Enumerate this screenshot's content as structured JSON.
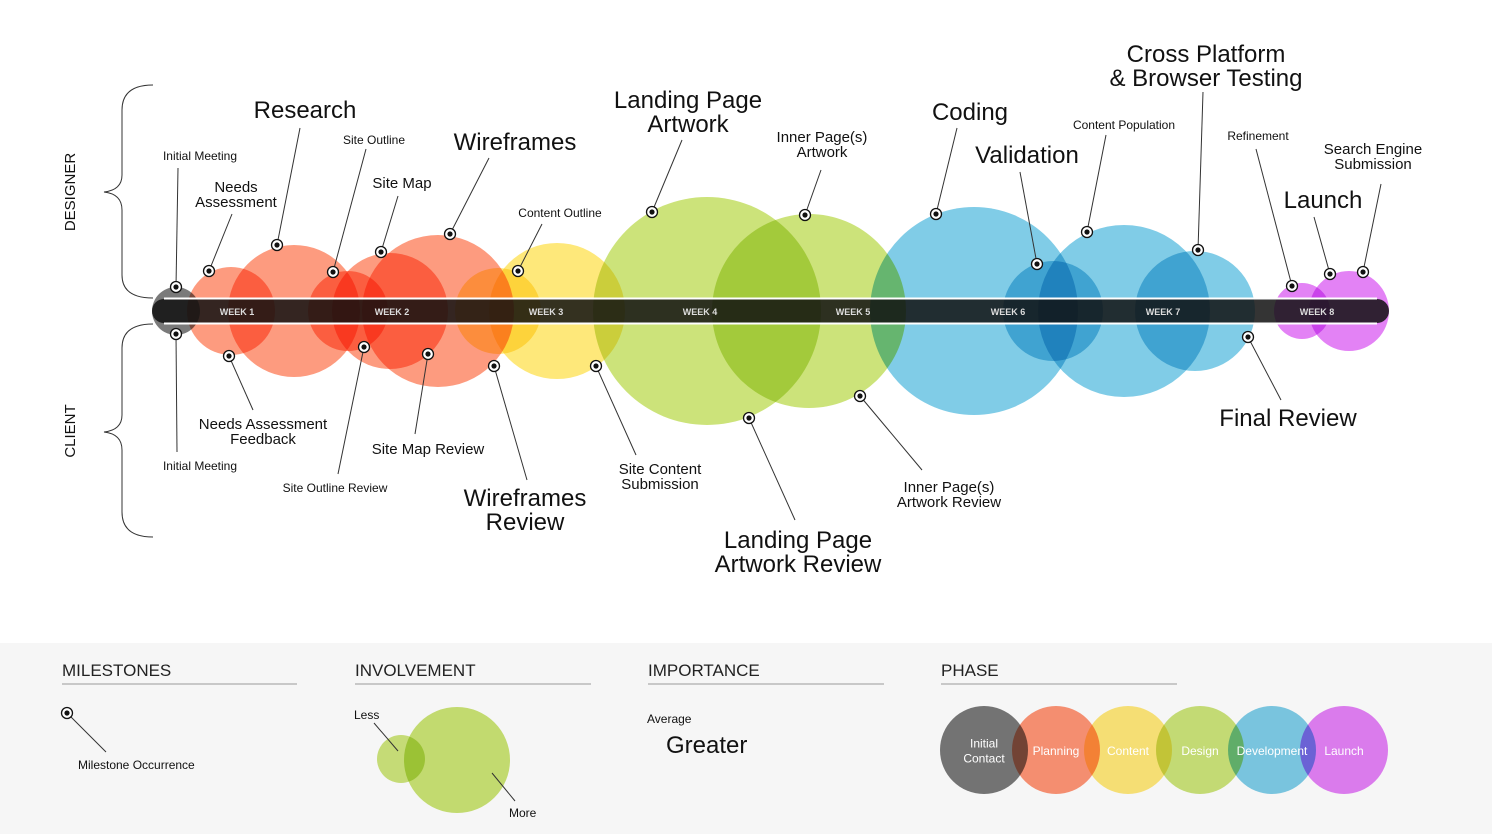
{
  "sides": {
    "designer": "DESIGNER",
    "client": "CLIENT"
  },
  "weeks": [
    "WEEK 1",
    "WEEK 2",
    "WEEK 3",
    "WEEK 4",
    "WEEK 5",
    "WEEK 6",
    "WEEK 7",
    "WEEK 8"
  ],
  "colors": {
    "initial_contact": "#6b6b6b",
    "planning": "#fd8a68",
    "content": "#fee56c",
    "design": "#c6e06c",
    "development": "#72c7e4",
    "launch": "#e074f4",
    "timeline_bar": "#1a1a1a",
    "legend_bg": "#f6f6f6"
  },
  "designer_milestones": [
    {
      "lines": [
        "Initial Meeting"
      ],
      "size": "sm"
    },
    {
      "lines": [
        "Needs",
        "Assessment"
      ],
      "size": "md"
    },
    {
      "lines": [
        "Research"
      ],
      "size": "lg"
    },
    {
      "lines": [
        "Site Outline"
      ],
      "size": "sm"
    },
    {
      "lines": [
        "Site Map"
      ],
      "size": "md"
    },
    {
      "lines": [
        "Wireframes"
      ],
      "size": "lg"
    },
    {
      "lines": [
        "Content Outline"
      ],
      "size": "sm"
    },
    {
      "lines": [
        "Landing Page",
        "Artwork"
      ],
      "size": "lg"
    },
    {
      "lines": [
        "Inner Page(s)",
        "Artwork"
      ],
      "size": "md"
    },
    {
      "lines": [
        "Coding"
      ],
      "size": "lg"
    },
    {
      "lines": [
        "Validation"
      ],
      "size": "lg"
    },
    {
      "lines": [
        "Content Population"
      ],
      "size": "sm"
    },
    {
      "lines": [
        "Cross Platform",
        "& Browser Testing"
      ],
      "size": "lg"
    },
    {
      "lines": [
        "Refinement"
      ],
      "size": "sm"
    },
    {
      "lines": [
        "Search Engine",
        "Submission"
      ],
      "size": "md"
    },
    {
      "lines": [
        "Launch"
      ],
      "size": "lg"
    }
  ],
  "client_milestones": [
    {
      "lines": [
        "Initial Meeting"
      ],
      "size": "sm"
    },
    {
      "lines": [
        "Needs Assessment",
        "Feedback"
      ],
      "size": "md"
    },
    {
      "lines": [
        "Site Outline Review"
      ],
      "size": "sm"
    },
    {
      "lines": [
        "Site Map Review"
      ],
      "size": "md"
    },
    {
      "lines": [
        "Wireframes",
        "Review"
      ],
      "size": "lg"
    },
    {
      "lines": [
        "Site Content",
        "Submission"
      ],
      "size": "md"
    },
    {
      "lines": [
        "Landing Page",
        "Artwork Review"
      ],
      "size": "lg"
    },
    {
      "lines": [
        "Inner Page(s)",
        "Artwork Review"
      ],
      "size": "md"
    },
    {
      "lines": [
        "Final Review"
      ],
      "size": "lg"
    }
  ],
  "legend": {
    "milestones": {
      "title": "MILESTONES",
      "item": "Milestone Occurrence"
    },
    "involvement": {
      "title": "INVOLVEMENT",
      "less": "Less",
      "more": "More"
    },
    "importance": {
      "title": "IMPORTANCE",
      "average": "Average",
      "greater": "Greater"
    },
    "phase": {
      "title": "PHASE",
      "items": [
        {
          "lines": [
            "Initial",
            "Contact"
          ],
          "color": "#6b6b6b"
        },
        {
          "lines": [
            "Planning"
          ],
          "color": "#fd8a68"
        },
        {
          "lines": [
            "Content"
          ],
          "color": "#fee56c"
        },
        {
          "lines": [
            "Design"
          ],
          "color": "#c6e06c"
        },
        {
          "lines": [
            "Development"
          ],
          "color": "#72c7e4"
        },
        {
          "lines": [
            "Launch"
          ],
          "color": "#e074f4"
        }
      ]
    }
  }
}
